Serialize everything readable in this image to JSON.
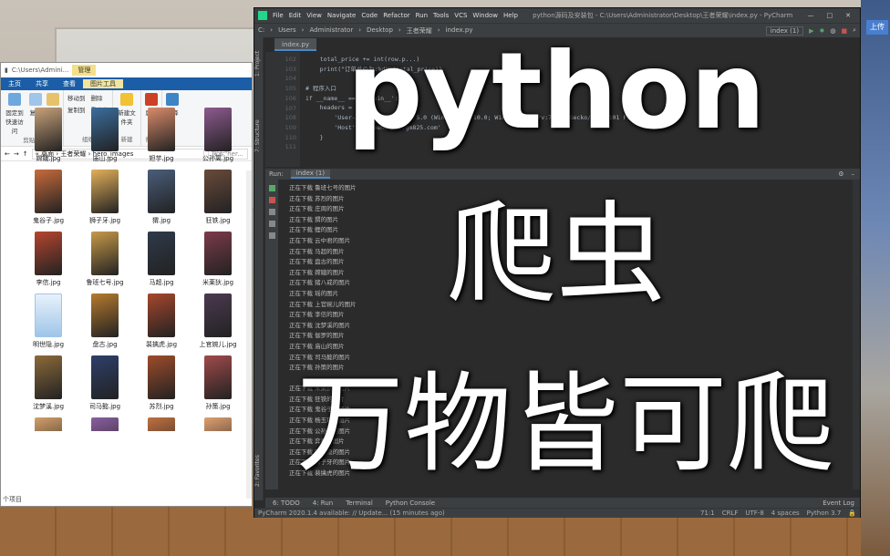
{
  "explorer": {
    "path_title": "C:\\Users\\Admini...",
    "manage_tab": "管理",
    "ribbon_tabs": [
      "主页",
      "共享",
      "查看",
      "图片工具"
    ],
    "ribbon": {
      "clipboard": {
        "pin": "固定到快速访问",
        "copy": "复制",
        "paste": "粘贴",
        "group": "剪贴板"
      },
      "organize": {
        "move_to": "移动到",
        "copy_to": "复制到",
        "delete": "删除",
        "rename": "重命名",
        "group": "组织"
      },
      "new": {
        "new_folder": "新建文件夹",
        "group": "新建"
      },
      "open": {
        "properties": "属性",
        "group": "打开"
      },
      "select": {
        "select": "选择"
      }
    },
    "address": [
      "« 桌面",
      "王者荣耀",
      "hero_images"
    ],
    "search_placeholder": "搜索\"her...",
    "files": [
      "嫦娥.jpg",
      "庙山.jpg",
      "妲芋.jpg",
      "公孙离.jpg",
      "鬼谷子.jpg",
      "狮子牙.jpg",
      "猬.jpg",
      "狂铁.jpg",
      "李信.jpg",
      "鲁班七号.jpg",
      "马超.jpg",
      "米莱狄.jpg",
      "明世隐.jpg",
      "盘古.jpg",
      "裴擒虎.jpg",
      "上官婉儿.jpg",
      "沈梦溪.jpg",
      "司马懿.jpg",
      "苏烈.jpg",
      "孙策.jpg",
      "",
      "",
      "",
      ""
    ],
    "status": "个项目"
  },
  "pycharm": {
    "title_menu": [
      "File",
      "Edit",
      "View",
      "Navigate",
      "Code",
      "Refactor",
      "Run",
      "Tools",
      "VCS",
      "Window",
      "Help"
    ],
    "window_title": "python源码及安装包 - C:\\Users\\Administrator\\Desktop\\王者荣耀\\index.py - PyCharm",
    "breadcrumbs": [
      "C:",
      "Users",
      "Administrator",
      "Desktop",
      "王者荣耀",
      "index.py"
    ],
    "run_config": "index (1)",
    "project_tab": "1: Project",
    "structure_tab": "7: Structure",
    "favorites_tab": "2: Favorites",
    "editor_tab": "index.py",
    "line_numbers": [
      "102",
      "103",
      "104",
      "105",
      "106",
      "107",
      "108",
      "109",
      "110",
      "111"
    ],
    "code_lines": [
      "    total_price += int(row.p...)",
      "    print(\"订单总价为:%d\"%(total_price))",
      "",
      "# 程序入口",
      "if __name__ == '__main__':",
      "    headers = {",
      "        'User-Agent': 'Mozilla/5.0 (Windows NT 10.0; Win64; x64; rv:76.0) Gecko/20100101 Firefox/76.0',",
      "        'Host': 'gamehelper.gm825.com'",
      "    }",
      ""
    ],
    "run_label": "Run:",
    "run_tab": "index (1)",
    "console_lines": [
      "正在下载 鲁班七号的图片",
      "正在下载 苏烈的图片",
      "正在下载 庄周的图片",
      "正在下载 猬的图片",
      "正在下载 鲤的图片",
      "正在下载 云中君的图片",
      "正在下载 马超的图片",
      "正在下载 盘古的图片",
      "正在下载 嫦娥的图片",
      "正在下载 猪八戒的图片",
      "正在下载 瑶的图片",
      "正在下载 上官婉儿的图片",
      "正在下载 李信的图片",
      "正在下载 沈梦溪的图片",
      "正在下载 伽罗的图片",
      "正在下载 庙山的图片",
      "正在下载 司马懿的图片",
      "正在下载 孙策的图片",
      "",
      "正在下载 米莱狄的图片",
      "正在下载 狂铁的图片",
      "正在下载 鬼谷子的图片",
      "正在下载 杨玉环的图片",
      "正在下载 公孙离的图片",
      "正在下载 弈星的图片",
      "正在下载 明世隐的图片",
      "正在下载 狮子牙的图片",
      "正在下载 裴擒虎的图片"
    ],
    "bottom_tabs": [
      "6: TODO",
      "4: Run",
      "Terminal",
      "Python Console"
    ],
    "event_log": "Event Log",
    "status_msg": "PyCharm 2020.1.4 available: // Update... (15 minutes ago)",
    "status_right": [
      "71:1",
      "CRLF",
      "UTF-8",
      "4 spaces",
      "Python 3.7"
    ]
  },
  "overlay": {
    "line1": "python",
    "line2": "爬虫",
    "line3": "万物皆可爬"
  },
  "desktop": {
    "upload_tag": "上传"
  },
  "colors": {
    "explorer_ribbon_blue": "#1b5ea7",
    "pycharm_bg": "#2b2b2b",
    "pycharm_panel": "#3c3f41",
    "accent_green": "#21d789"
  }
}
